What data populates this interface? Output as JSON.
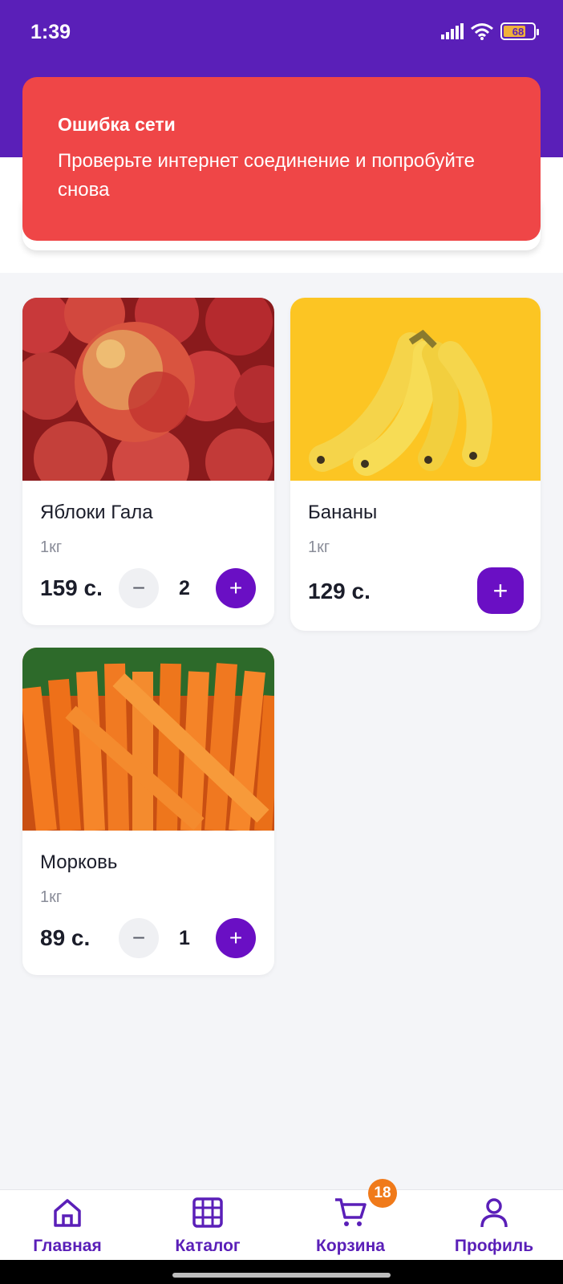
{
  "status_bar": {
    "time": "1:39",
    "battery": "68"
  },
  "error_toast": {
    "title": "Ошибка сети",
    "message": "Проверьте интернет соединение и попробуйте снова"
  },
  "products": [
    {
      "name": "Яблоки Гала",
      "unit": "1кг",
      "price": "159 с.",
      "quantity": "2",
      "image": "red-apples"
    },
    {
      "name": "Бананы",
      "unit": "1кг",
      "price": "129 с.",
      "image": "bananas"
    },
    {
      "name": "Морковь",
      "unit": "1кг",
      "price": "89 с.",
      "quantity": "1",
      "image": "carrots"
    }
  ],
  "controls": {
    "minus": "−",
    "plus": "+"
  },
  "bottom_nav": {
    "items": [
      {
        "label": "Главная",
        "icon": "home-icon"
      },
      {
        "label": "Каталог",
        "icon": "grid-icon"
      },
      {
        "label": "Корзина",
        "icon": "cart-icon",
        "badge": "18"
      },
      {
        "label": "Профиль",
        "icon": "user-icon"
      }
    ]
  },
  "colors": {
    "header": "#5a1fb8",
    "error": "#ef4647",
    "accent": "#6a0fc4",
    "badge": "#f07a1a"
  }
}
